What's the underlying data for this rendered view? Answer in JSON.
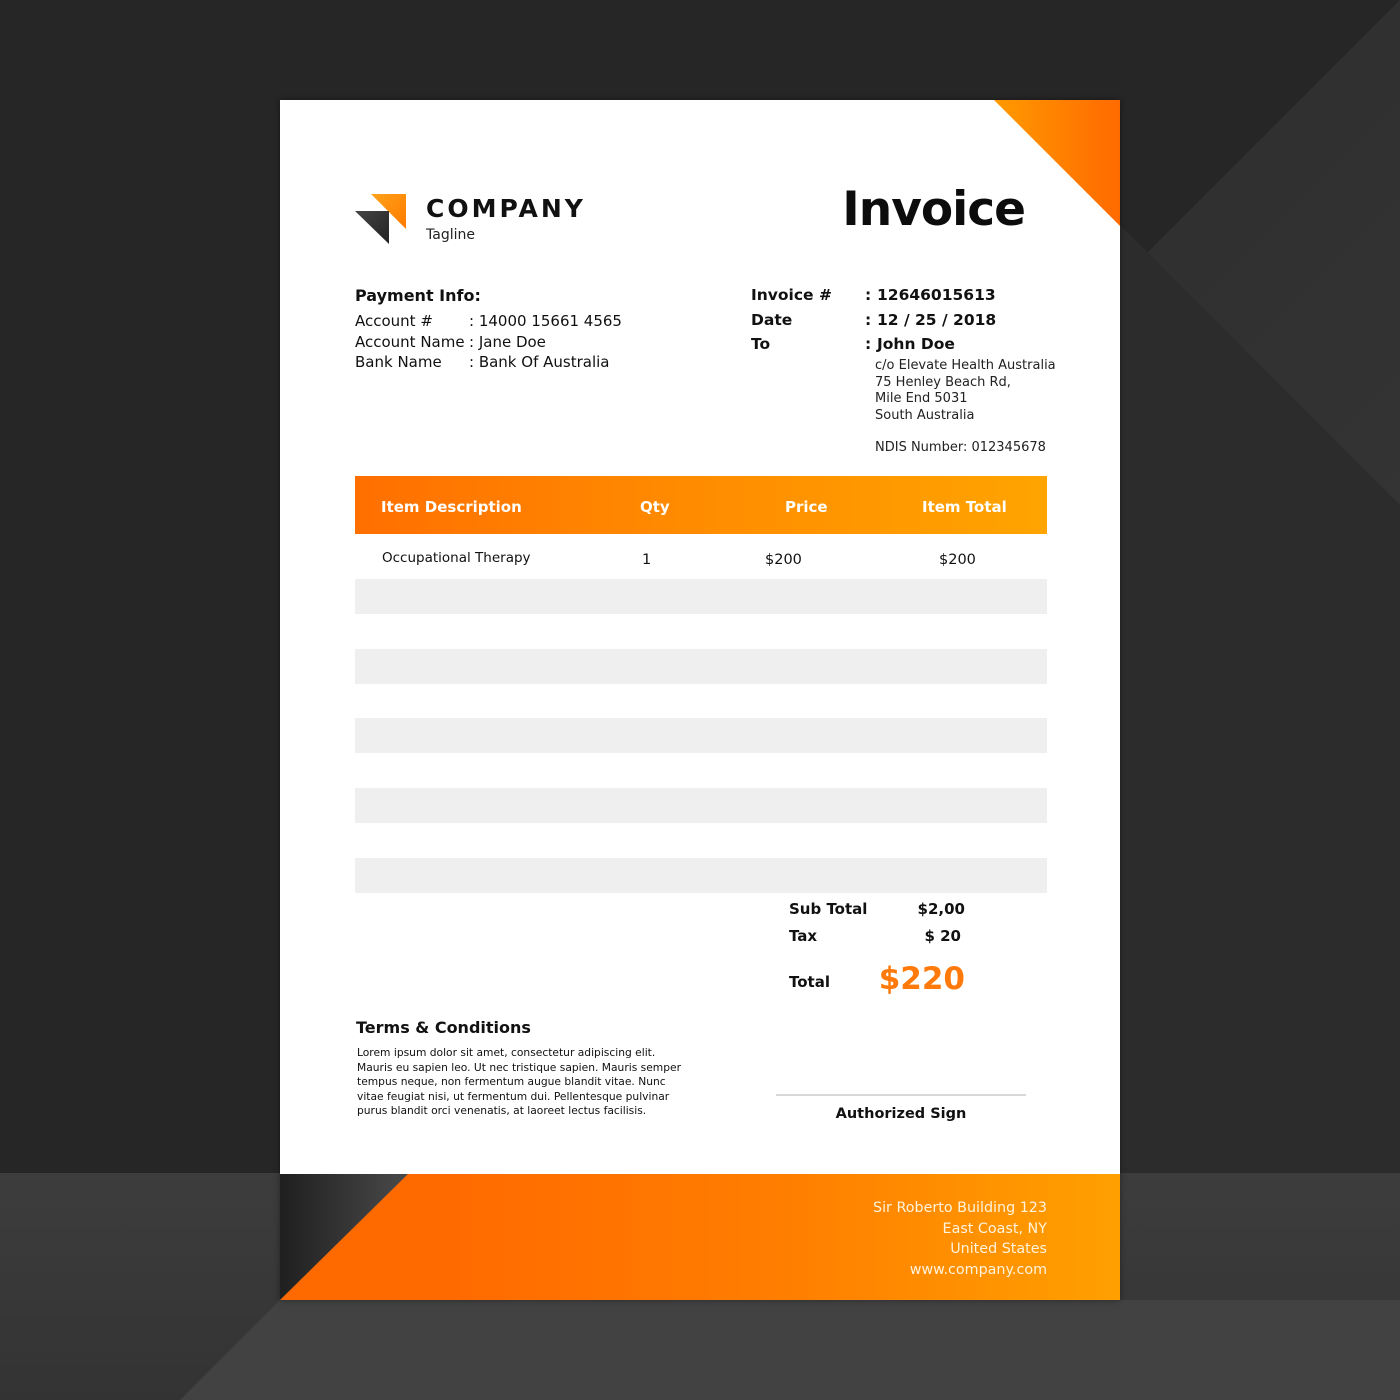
{
  "company": {
    "name": "COMPANY",
    "tagline": "Tagline"
  },
  "document_title": "Invoice",
  "payment_info": {
    "heading": "Payment Info:",
    "rows": [
      {
        "label": "Account #",
        "value": ": 14000 15661 4565"
      },
      {
        "label": "Account Name",
        "value": ": Jane Doe"
      },
      {
        "label": "Bank Name",
        "value": ": Bank Of Australia"
      }
    ]
  },
  "invoice_meta": {
    "rows": [
      {
        "label": "Invoice #",
        "value": "12646015613"
      },
      {
        "label": "Date",
        "value": "12 / 25 / 2018"
      },
      {
        "label": "To",
        "value": "John Doe"
      }
    ],
    "separator": ":",
    "address_lines": [
      "c/o Elevate Health Australia",
      "75 Henley Beach Rd,",
      "Mile End  5031",
      "South Australia"
    ],
    "ndis": "NDIS Number: 012345678"
  },
  "table": {
    "columns": [
      "Item Description",
      "Qty",
      "Price",
      "Item Total"
    ],
    "rows": [
      {
        "description": "Occupational Therapy",
        "qty": "1",
        "price": "$200",
        "total": "$200"
      }
    ],
    "empty_striped_rows": 5
  },
  "totals": {
    "subtotal_label": "Sub Total",
    "subtotal_value": "$2,00",
    "tax_label": "Tax",
    "tax_value": "$ 20",
    "total_label": "Total",
    "total_value": "$220"
  },
  "terms": {
    "heading": "Terms & Conditions",
    "text": "Lorem ipsum dolor sit amet, consectetur adipiscing elit. Mauris eu sapien leo. Ut nec tristique sapien. Mauris semper tempus neque, non fermentum augue blandit vitae. Nunc vitae feugiat nisi, ut fermentum dui. Pellentesque pulvinar purus blandit orci venenatis, at laoreet lectus facilisis."
  },
  "signature": {
    "label": "Authorized Sign"
  },
  "footer": {
    "address_lines": [
      "Sir Roberto Building 123",
      "East Coast, NY",
      "United States",
      "www.company.com"
    ]
  },
  "colors": {
    "accent_orange": "#ff7a0a",
    "accent_amber": "#ffa400",
    "background_dark": "#262626",
    "stripe_gray": "#efefef"
  }
}
